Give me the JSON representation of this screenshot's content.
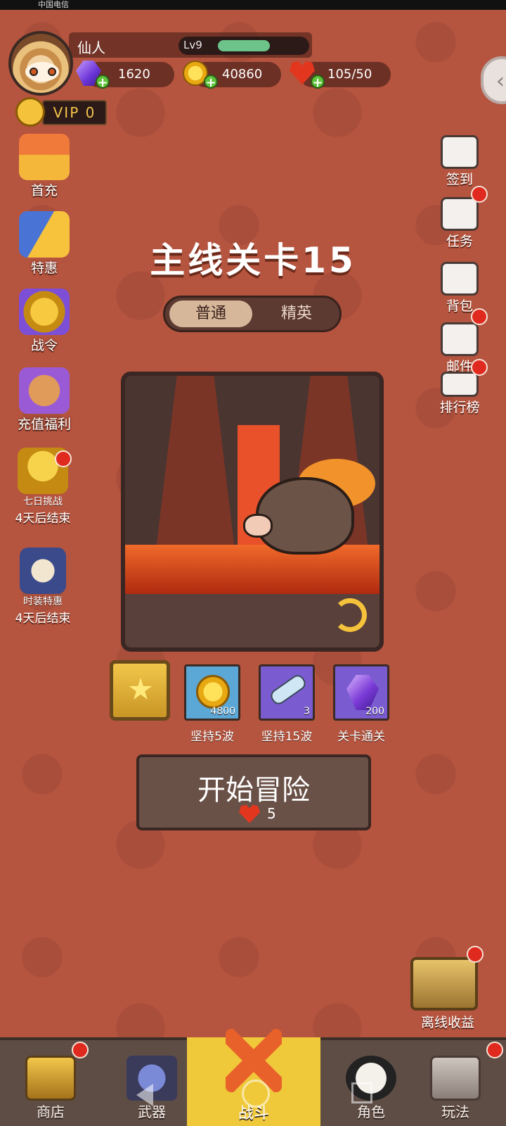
{
  "status_bar": {
    "carrier": "中国电信"
  },
  "player": {
    "name": "仙人",
    "level": "Lv9",
    "level_progress": 0.6
  },
  "resources": {
    "gems": "1620",
    "coins": "40860",
    "energy": "105/50"
  },
  "vip": {
    "label": "VIP 0"
  },
  "left_menu": [
    {
      "label": "首充"
    },
    {
      "label": "特惠"
    },
    {
      "label": "战令"
    },
    {
      "label": "充值福利"
    },
    {
      "label": "七日挑战",
      "sub": "4天后结束"
    },
    {
      "label": "时装特惠",
      "sub": "4天后结束"
    }
  ],
  "right_menu": [
    {
      "label": "签到"
    },
    {
      "label": "任务"
    },
    {
      "label": "背包"
    },
    {
      "label": "邮件"
    },
    {
      "label": "排行榜"
    }
  ],
  "stage": {
    "title": "主线关卡15"
  },
  "modes": {
    "normal": "普通",
    "elite": "精英",
    "selected": "普通"
  },
  "rewards": [
    {
      "count": "4800",
      "label": "坚持5波",
      "icon": "coin-icon"
    },
    {
      "count": "3",
      "label": "坚持15波",
      "icon": "key-icon"
    },
    {
      "count": "200",
      "label": "关卡通关",
      "icon": "gem-icon"
    }
  ],
  "start": {
    "label": "开始冒险",
    "cost": "5"
  },
  "offline": {
    "label": "离线收益"
  },
  "bottom_nav": [
    {
      "label": "商店"
    },
    {
      "label": "武器"
    },
    {
      "label": "战斗",
      "active": true
    },
    {
      "label": "角色"
    },
    {
      "label": "玩法"
    }
  ],
  "colors": {
    "background": "#b5543f",
    "nav_active": "#f0c93a",
    "notify": "#e02a1f",
    "level_bar": "#6cc48a"
  }
}
